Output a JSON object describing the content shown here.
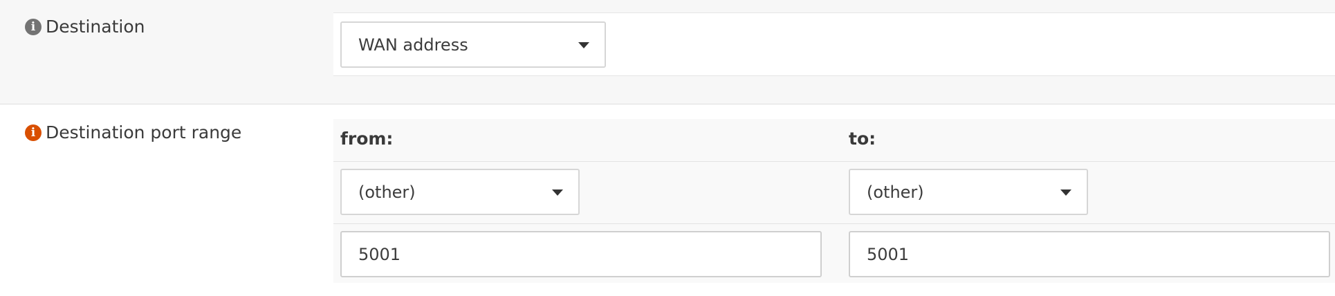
{
  "destination": {
    "label": "Destination",
    "info_icon": "info-icon",
    "info_icon_color": "#737373",
    "select_value": "WAN address"
  },
  "port_range": {
    "label": "Destination port range",
    "info_icon": "info-icon",
    "info_icon_color": "#d94f00",
    "from_header": "from:",
    "to_header": "to:",
    "from_select_value": "(other)",
    "to_select_value": "(other)",
    "from_port_value": "5001",
    "to_port_value": "5001"
  }
}
